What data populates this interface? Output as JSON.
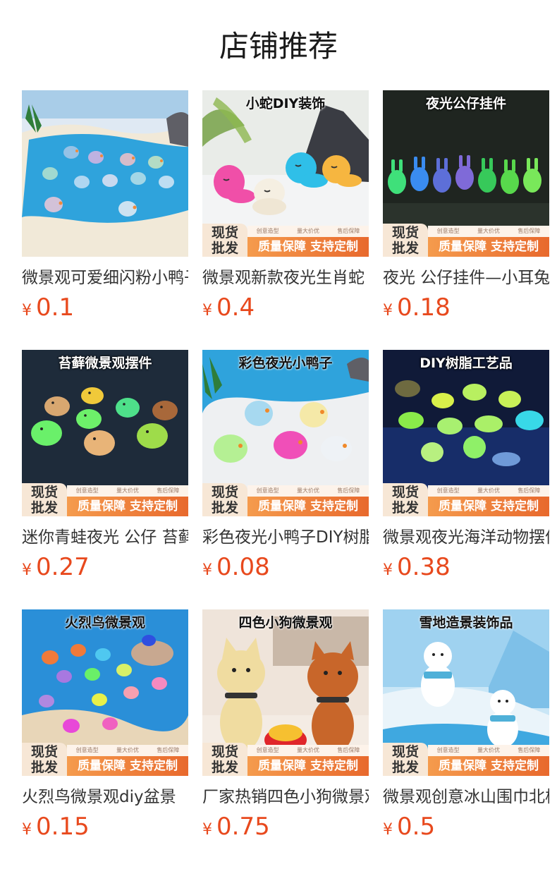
{
  "section_title": "店铺推荐",
  "promo": {
    "line1": "现货",
    "line2": "批发",
    "tags": [
      "创意造型",
      "量大价优",
      "售后保障"
    ],
    "bar": "质量保障 支持定制"
  },
  "products": [
    {
      "banner": "",
      "name": "微景观可爱细闪粉小鸭子",
      "currency": "¥",
      "price": "0.1"
    },
    {
      "banner": "小蛇DIY装饰",
      "name": "微景观新款夜光生肖蛇",
      "currency": "¥",
      "price": "0.4"
    },
    {
      "banner": "夜光公仔挂件",
      "name": "夜光 公仔挂件—小耳兔",
      "currency": "¥",
      "price": "0.18"
    },
    {
      "banner": "苔藓微景观摆件",
      "name": "迷你青蛙夜光 公仔 苔藓",
      "currency": "¥",
      "price": "0.27"
    },
    {
      "banner": "彩色夜光小鸭子",
      "name": "彩色夜光小鸭子DIY树脂",
      "currency": "¥",
      "price": "0.08"
    },
    {
      "banner": "DIY树脂工艺品",
      "name": "微景观夜光海洋动物摆件",
      "currency": "¥",
      "price": "0.38"
    },
    {
      "banner": "火烈鸟微景观",
      "name": "火烈鸟微景观diy盆景",
      "currency": "¥",
      "price": "0.15"
    },
    {
      "banner": "四色小狗微景观",
      "name": "厂家热销四色小狗微景观",
      "currency": "¥",
      "price": "0.75"
    },
    {
      "banner": "雪地造景装饰品",
      "name": "微景观创意冰山围巾北极熊",
      "currency": "¥",
      "price": "0.5"
    }
  ]
}
